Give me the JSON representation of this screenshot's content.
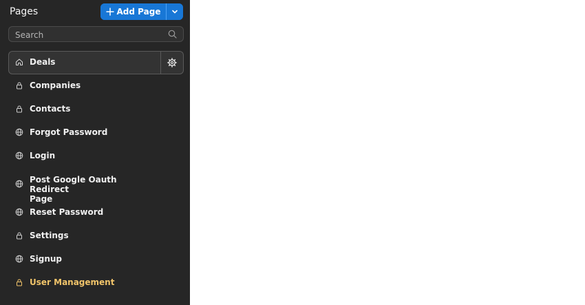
{
  "sidebar": {
    "title": "Pages",
    "add_page_label": "Add Page",
    "search": {
      "placeholder": "Search",
      "value": ""
    },
    "items": [
      {
        "label": "Deals",
        "icon": "home-icon",
        "active": true
      },
      {
        "label": "Companies",
        "icon": "lock-icon"
      },
      {
        "label": "Contacts",
        "icon": "lock-icon"
      },
      {
        "label": "Forgot Password",
        "icon": "globe-icon"
      },
      {
        "label": "Login",
        "icon": "globe-icon"
      },
      {
        "label": "Post Google Oauth Redirect\nPage",
        "icon": "globe-icon"
      },
      {
        "label": "Reset Password",
        "icon": "globe-icon"
      },
      {
        "label": "Settings",
        "icon": "lock-icon"
      },
      {
        "label": "Signup",
        "icon": "globe-icon"
      },
      {
        "label": "User Management",
        "icon": "lock-icon",
        "color": "#f1c46a"
      }
    ]
  },
  "colors": {
    "sidebar_bg": "#262626",
    "accent": "#1877d6",
    "highlight": "#f1c46a",
    "content_bg": "#ffffff"
  }
}
